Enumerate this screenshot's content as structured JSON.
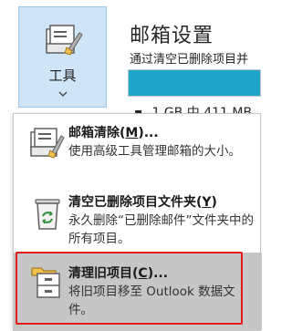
{
  "ribbon": {
    "tools_label": "工具"
  },
  "panel": {
    "title": "邮箱设置",
    "description": "通过清空已删除项目并",
    "quota_fill": 1.0,
    "quota_text": "1 GB 中 411 MB"
  },
  "menu": {
    "items": [
      {
        "title_prefix": "邮箱清除(",
        "title_key": "M",
        "title_suffix": ")...",
        "description": "使用高级工具管理邮箱的大小。"
      },
      {
        "title_prefix": "清空已删除项目文件夹(",
        "title_key": "Y",
        "title_suffix": ")",
        "description": "永久删除“已删除邮件”文件夹中的所有项目。"
      },
      {
        "title_prefix": "清理旧项目(",
        "title_key": "C",
        "title_suffix": ")...",
        "description": "将旧项目移至 Outlook 数据文件。"
      }
    ]
  },
  "colors": {
    "button_bg": "#cfe5f7",
    "quota_fill": "#1fa3c8",
    "highlight_bg": "#c6c6c6",
    "callout_red": "#e21b1b"
  }
}
